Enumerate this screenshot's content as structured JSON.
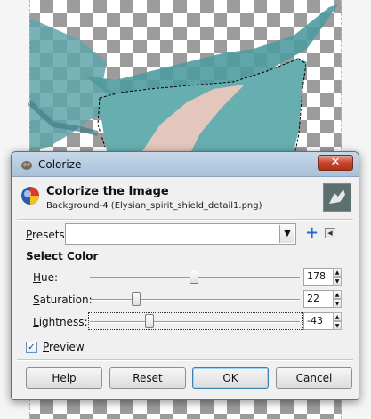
{
  "window": {
    "title": "Colorize",
    "close_glyph": "✕"
  },
  "header": {
    "title": "Colorize the Image",
    "subtitle": "Background-4 (Elysian_spirit_shield_detail1.png)"
  },
  "presets": {
    "label_rest": "resets:",
    "label_mnemonic": "P",
    "value": ""
  },
  "section": {
    "title": "Select Color"
  },
  "sliders": {
    "hue": {
      "label_mnemonic": "H",
      "label_rest": "ue:",
      "value": "178",
      "max": 360,
      "level": 178
    },
    "saturation": {
      "label_mnemonic": "S",
      "label_rest": "aturation:",
      "value": "22",
      "max": 100,
      "level": 22
    },
    "lightness": {
      "label_mnemonic": "L",
      "label_rest": "ightness:",
      "value": "-43",
      "min": -100,
      "max": 100,
      "level": -43
    }
  },
  "preview": {
    "label_mnemonic": "P",
    "label_rest": "review",
    "checked": true
  },
  "buttons": {
    "help": {
      "mnemonic": "H",
      "rest": "elp"
    },
    "reset": {
      "mnemonic": "R",
      "rest": "eset"
    },
    "ok": {
      "mnemonic": "O",
      "rest": "K"
    },
    "cancel": {
      "mnemonic": "C",
      "rest": "ancel"
    }
  },
  "icons": {
    "app": "gimp-icon",
    "header": "colorize-icon",
    "add_preset": "plus-icon",
    "preset_menu": "menu-icon"
  },
  "colors": {
    "accent": "#3c7fb1",
    "teal": "#5aa3a8",
    "pink": "#e6c6bd"
  }
}
